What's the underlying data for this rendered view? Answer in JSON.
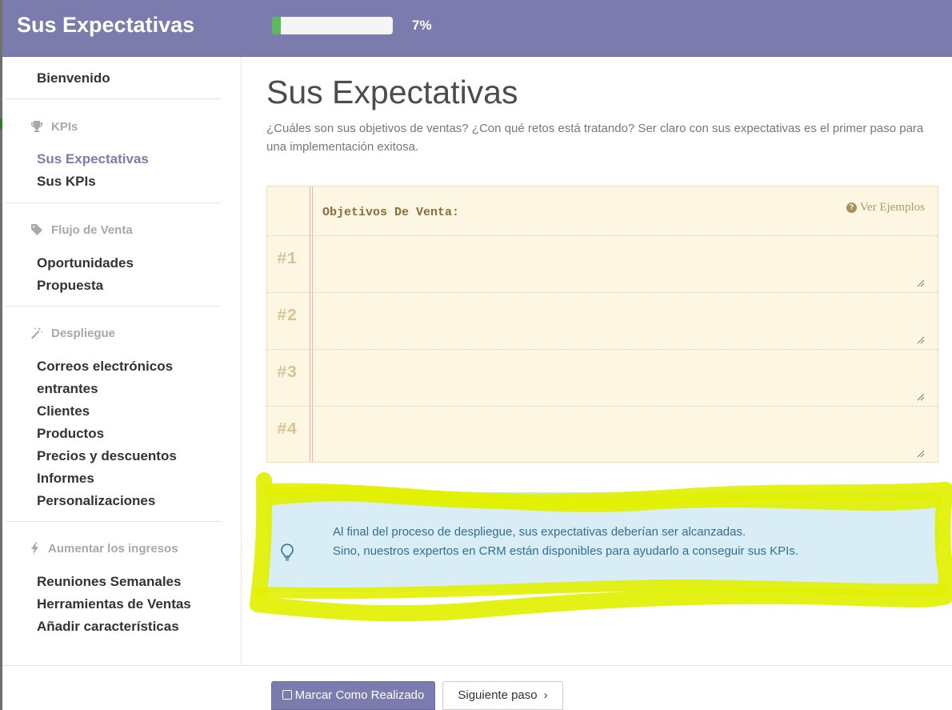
{
  "header": {
    "title": "Sus Expectativas",
    "progress_value": 0.07,
    "progress_text": "7%"
  },
  "sidebar": {
    "welcome": "Bienvenido",
    "sections": [
      {
        "heading": "KPIs",
        "icon": "trophy-icon",
        "items": [
          "Sus Expectativas",
          "Sus KPIs"
        ]
      },
      {
        "heading": "Flujo de Venta",
        "icon": "tag-icon",
        "items": [
          "Oportunidades",
          "Propuesta"
        ]
      },
      {
        "heading": "Despliegue",
        "icon": "magic-wand-icon",
        "items": [
          "Correos electrónicos",
          "entrantes",
          "Clientes",
          "Productos",
          "Precios y descuentos",
          "Informes",
          "Personalizaciones"
        ]
      },
      {
        "heading": "Aumentar los ingresos",
        "icon": "bolt-icon",
        "items": [
          "Reuniones Semanales",
          "Herramientas de Ventas",
          "Añadir características"
        ]
      }
    ],
    "active_item": "Sus Expectativas"
  },
  "main": {
    "title": "Sus Expectativas",
    "subtitle": "¿Cuáles son sus objetivos de ventas? ¿Con qué retos está tratando? Ser claro con sus expectativas es el primer paso para una implementación exitosa.",
    "notebook": {
      "header": "Objetivos De Venta:",
      "examples_link": "Ver Ejemplos",
      "rows": [
        "#1",
        "#2",
        "#3",
        "#4"
      ]
    },
    "hint": {
      "line1": "Al final del proceso de despliegue, sus expectativas deberían ser alcanzadas.",
      "line2": "Sino, nuestros expertos en CRM están disponibles para ayudarlo a conseguir sus KPIs."
    }
  },
  "footer": {
    "done_button": "Marcar Como Realizado",
    "next_button": "Siguiente paso"
  },
  "colors": {
    "topbar": "#7c7bad",
    "accent": "#7c7bad",
    "progress": "#5cb85c",
    "notebook": "#fcf6e2",
    "hint": "#d9edf7",
    "highlight": "#e2f000"
  }
}
